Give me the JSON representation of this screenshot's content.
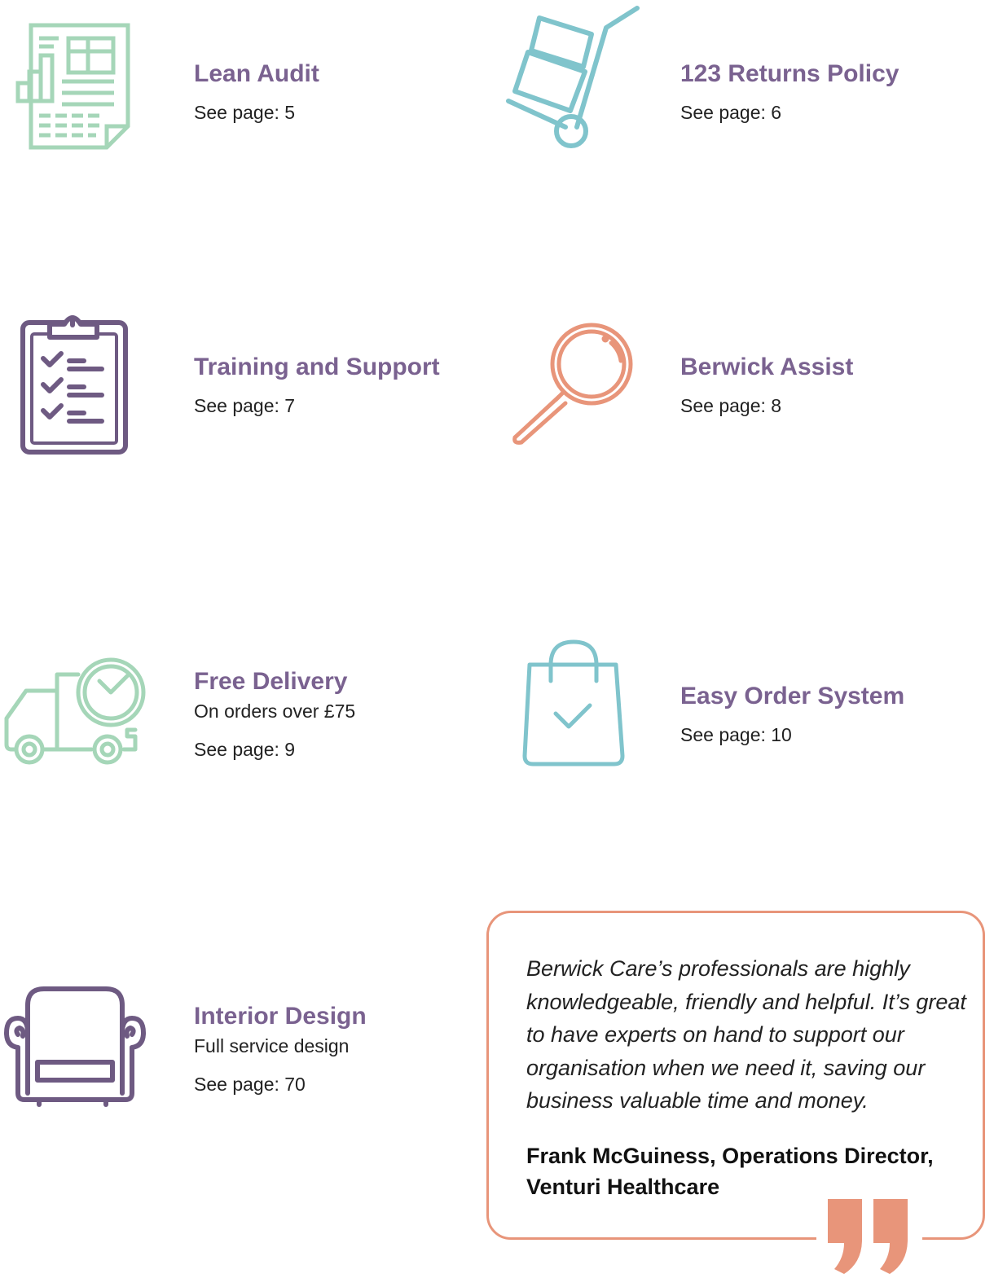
{
  "colors": {
    "title": "#7a6290",
    "green": "#a5d6b8",
    "teal": "#80c4cc",
    "purple": "#6e5a82",
    "orange": "#e8957a",
    "text": "#222222"
  },
  "services": [
    {
      "title": "Lean Audit",
      "page_label": "See page: 5",
      "icon": "report-chart-icon"
    },
    {
      "title": "123 Returns Policy",
      "page_label": "See page: 6",
      "icon": "hand-truck-icon"
    },
    {
      "title": "Training and Support",
      "page_label": "See page: 7",
      "icon": "clipboard-checklist-icon"
    },
    {
      "title": "Berwick Assist",
      "page_label": "See page: 8",
      "icon": "magnifying-glass-icon"
    },
    {
      "title": "Free Delivery",
      "subtitle": "On orders over £75",
      "page_label": "See page: 9",
      "icon": "delivery-truck-clock-icon"
    },
    {
      "title": "Easy Order System",
      "page_label": "See page: 10",
      "icon": "shopping-bag-check-icon"
    },
    {
      "title": "Interior Design",
      "subtitle": "Full service design",
      "page_label": "See page: 70",
      "icon": "armchair-icon"
    }
  ],
  "testimonial": {
    "quote": "Berwick Care’s professionals are highly knowledgeable, friendly and helpful. It’s great to have experts on hand to support our organisation when we need it, saving our business valuable time and money.",
    "author_line1": "Frank McGuiness, Operations Director,",
    "author_line2": "Venturi Healthcare",
    "icon": "closing-quote-icon"
  }
}
